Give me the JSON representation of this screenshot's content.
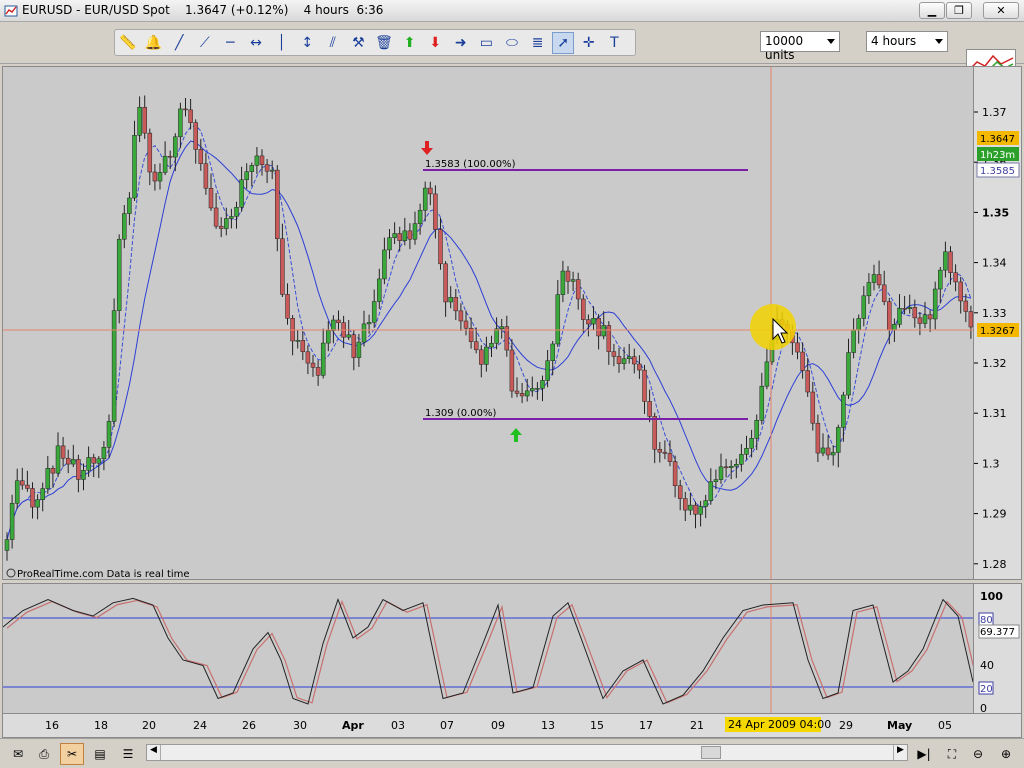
{
  "window": {
    "title": "EURUSD - EUR/USD Spot    1.3647 (+0.12%)    4 hours  6:36"
  },
  "toolbar": {
    "units_select": "10000 units",
    "timeframe_select": "4 hours",
    "tools": [
      "ruler-icon",
      "bell-icon",
      "line-icon",
      "trendline-icon",
      "horizontal-line-icon",
      "horizontal-segment-icon",
      "vertical-line-icon",
      "vertical-arrow-icon",
      "parallel-channel-icon",
      "fan-icon",
      "trash-icon",
      "buy-arrow-icon",
      "sell-arrow-icon",
      "forward-arrow-icon",
      "rectangle-icon",
      "ellipse-icon",
      "fibonacci-icon",
      "cursor-icon",
      "crosshair-icon",
      "text-icon"
    ]
  },
  "chart": {
    "price_ticks": [
      "1.37",
      "1.36",
      "1.35",
      "1.34",
      "1.33",
      "1.32",
      "1.31",
      "1.3",
      "1.29",
      "1.28"
    ],
    "badges": {
      "last_price": "1.3647",
      "countdown": "1h23m",
      "level": "1.3585",
      "crosshair_price": "1.3267"
    },
    "fib_high_label": "1.3583 (100.00%)",
    "fib_low_label": "1.309 (0.00%)",
    "watermark": "ProRealTime.com  Data is real time",
    "colors": {
      "up": "#3aa83a",
      "down": "#c85a5a",
      "fib": "#7a1fa6",
      "ma": "#2b3fd6",
      "crosshair": "#e8846a",
      "badge_last": "#f5b800",
      "badge_level": "#ffffff",
      "badge_cross": "#f5b800"
    }
  },
  "oscillator": {
    "ticks": [
      "100",
      "80",
      "69.377",
      "40",
      "20",
      "0"
    ],
    "upper_level": "80",
    "lower_level": "20",
    "value_badge": "69.377"
  },
  "dates": {
    "labels": [
      "16",
      "18",
      "20",
      "24",
      "26",
      "30",
      "Apr",
      "03",
      "07",
      "09",
      "13",
      "15",
      "17",
      "21",
      "29",
      "May",
      "05"
    ],
    "crosshair_date": "24 Apr 2009 04:00"
  }
}
